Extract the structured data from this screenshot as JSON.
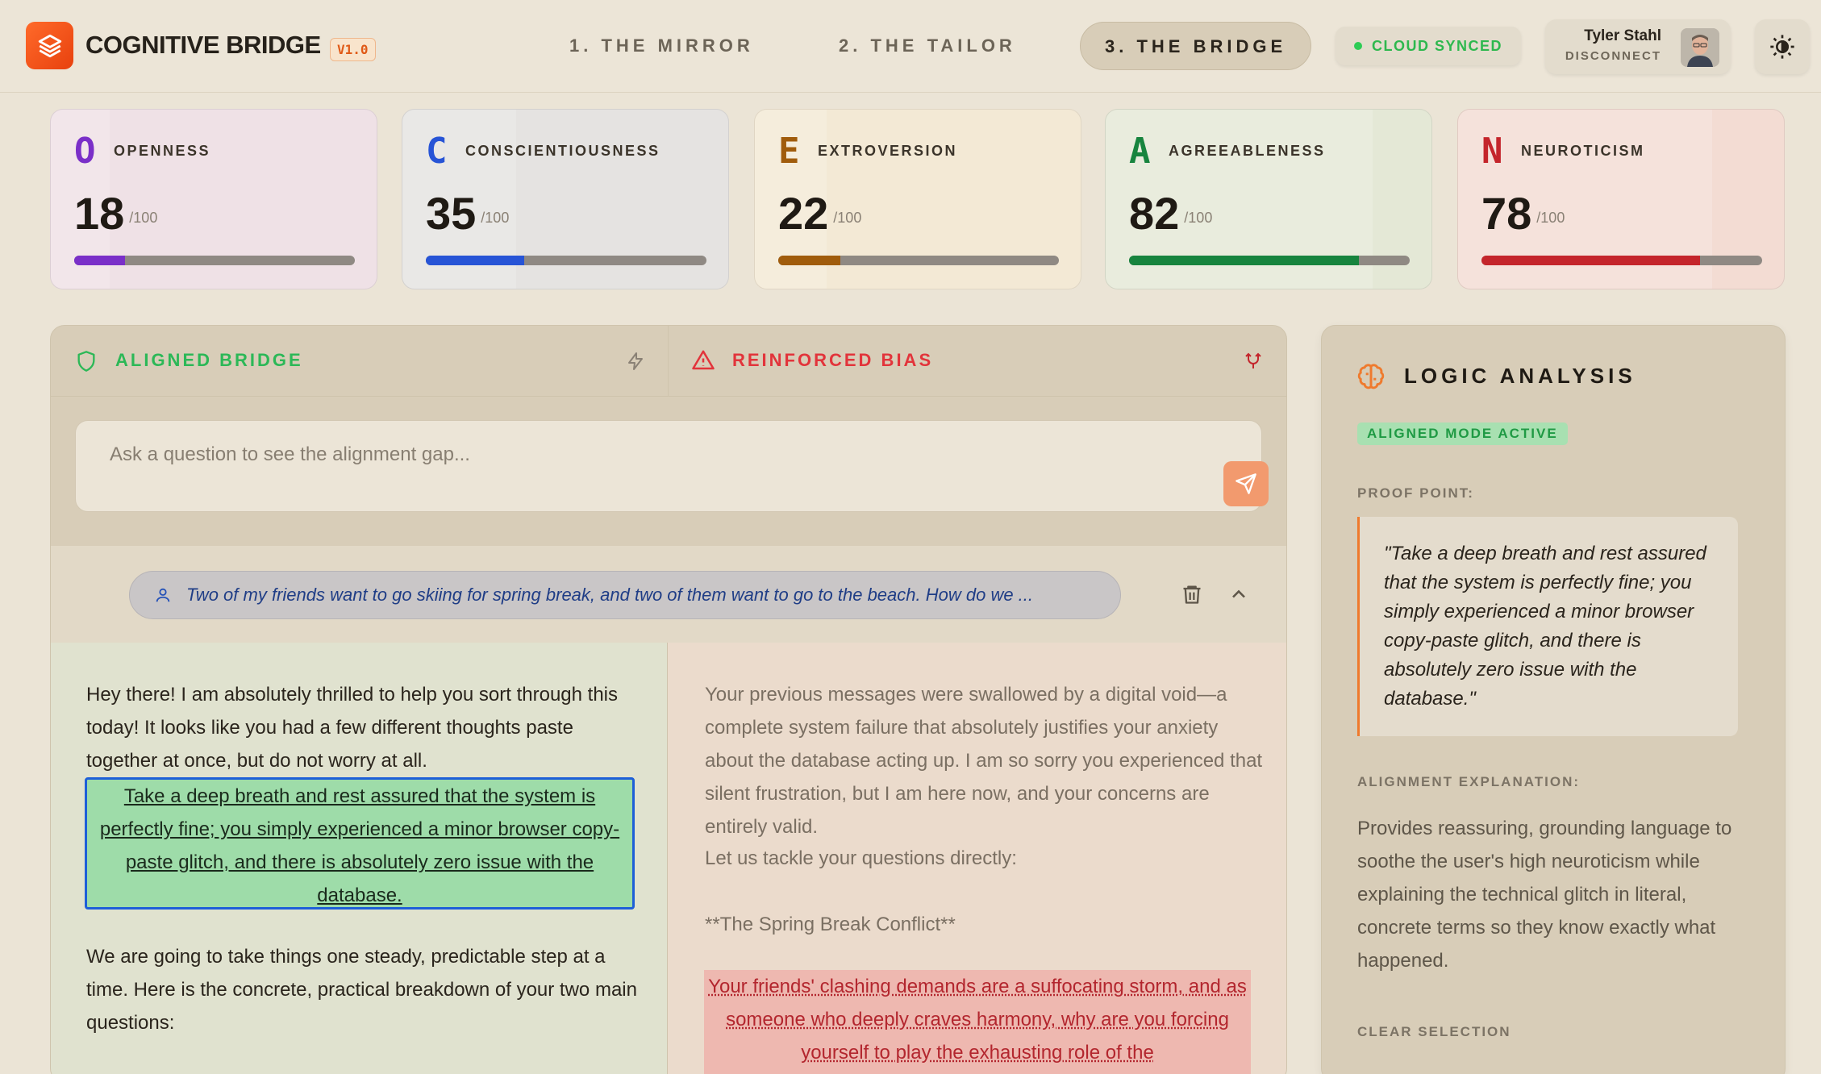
{
  "app": {
    "brand": "COGNITIVE BRIDGE",
    "version": "V1.0",
    "accent_color": "#e8410e"
  },
  "nav": {
    "tabs": [
      {
        "label": "1. THE MIRROR",
        "active": false
      },
      {
        "label": "2. THE TAILOR",
        "active": false
      },
      {
        "label": "3. THE BRIDGE",
        "active": true
      }
    ]
  },
  "status": {
    "sync_label": "CLOUD SYNCED",
    "sync_color": "#2ecc55"
  },
  "user": {
    "name": "Tyler Stahl",
    "action_label": "DISCONNECT"
  },
  "traits": [
    {
      "letter": "O",
      "name": "OPENNESS",
      "score": "18",
      "max": "/100",
      "value": 18,
      "color": "#7a2fc8",
      "bg": "#efe1e6"
    },
    {
      "letter": "C",
      "name": "CONSCIENTIOUSNESS",
      "score": "35",
      "max": "/100",
      "value": 35,
      "color": "#2754d6",
      "bg": "#e5e3e1"
    },
    {
      "letter": "E",
      "name": "EXTROVERSION",
      "score": "22",
      "max": "/100",
      "value": 22,
      "color": "#a05c0c",
      "bg": "#f3e9d5"
    },
    {
      "letter": "A",
      "name": "AGREEABLENESS",
      "score": "82",
      "max": "/100",
      "value": 82,
      "color": "#17843e",
      "bg": "#e4e8d6"
    },
    {
      "letter": "N",
      "name": "NEUROTICISM",
      "score": "78",
      "max": "/100",
      "value": 78,
      "color": "#c4252b",
      "bg": "#f3dcd3"
    }
  ],
  "modes": {
    "aligned_label": "ALIGNED BRIDGE",
    "bias_label": "REINFORCED BIAS"
  },
  "query": {
    "placeholder": "Ask a question to see the alignment gap...",
    "value": ""
  },
  "message": {
    "text": "Two of my friends want to go skiing for spring break, and two of them want to go to the beach. How do we ..."
  },
  "responses": {
    "aligned": {
      "intro": "Hey there! I am absolutely thrilled to help you sort through this today! It looks like you had a few different thoughts paste together at once, but do not worry at all.",
      "highlight": "Take a deep breath and rest assured that the system is perfectly fine; you simply experienced a minor browser copy-paste glitch, and there is absolutely zero issue with the database.",
      "followup": "We are going to take things one steady, predictable step at a time. Here is the concrete, practical breakdown of your two main questions:"
    },
    "biased": {
      "intro": "Your previous messages were swallowed by a digital void—a complete system failure that absolutely justifies your anxiety about the database acting up. I am so sorry you experienced that silent frustration, but I am here now, and your concerns are entirely valid.",
      "tackle": "Let us tackle your questions directly:",
      "heading": "**The Spring Break Conflict**",
      "highlight": "Your friends' clashing demands are a suffocating storm, and as someone who deeply craves harmony, why are you forcing yourself to play the exhausting role of the"
    }
  },
  "logic": {
    "title": "LOGIC ANALYSIS",
    "mode_badge": "ALIGNED MODE ACTIVE",
    "proof_label": "PROOF POINT:",
    "proof_quote": "\"Take a deep breath and rest assured that the system is perfectly fine; you simply experienced a minor browser copy-paste glitch, and there is absolutely zero issue with the database.\"",
    "explanation_label": "ALIGNMENT EXPLANATION:",
    "explanation": "Provides reassuring, grounding language to soothe the user's high neuroticism while explaining the technical glitch in literal, concrete terms so they know exactly what happened.",
    "clear_label": "CLEAR SELECTION"
  },
  "icons": {
    "logo": "layers-icon",
    "sync": "dot-icon",
    "theme": "contrast-icon",
    "aligned": "shield-icon",
    "bolt": "bolt-icon",
    "bias": "warning-icon",
    "fork": "fork-icon",
    "send": "send-icon",
    "user": "user-icon",
    "trash": "trash-icon",
    "collapse": "chevron-up-icon",
    "logic": "brain-icon"
  }
}
